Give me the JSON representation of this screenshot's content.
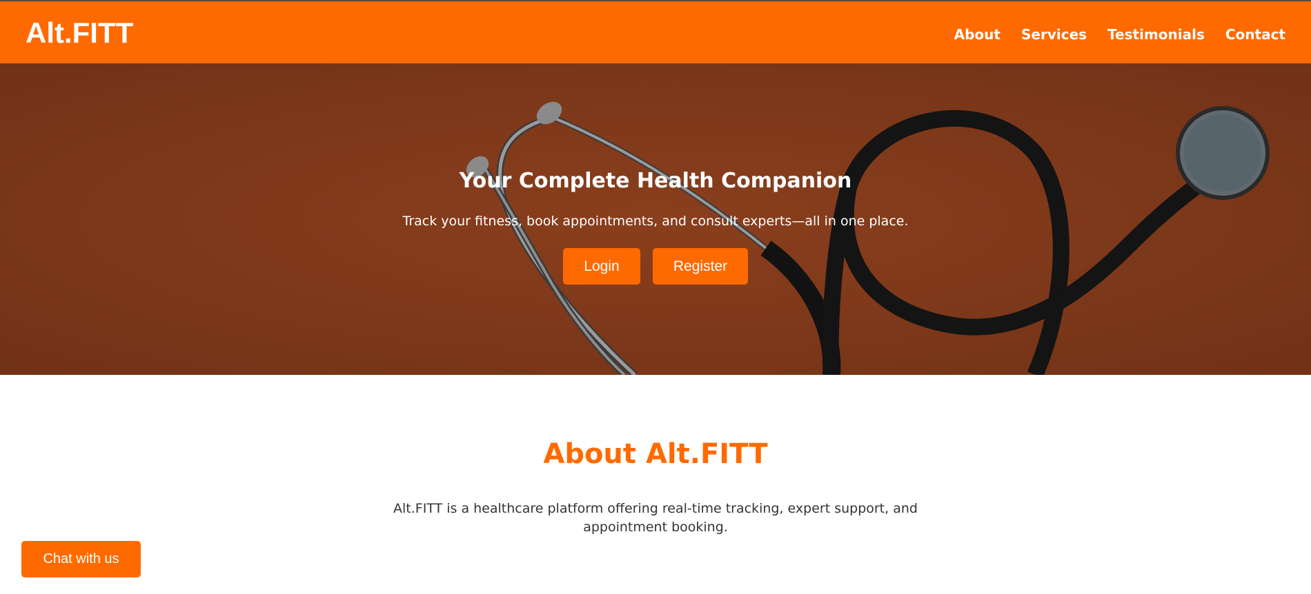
{
  "brand": {
    "logo": "Alt.FITT",
    "accent": "#ff6a00",
    "hero_bg": "#7b371a"
  },
  "nav": {
    "items": [
      {
        "label": "About"
      },
      {
        "label": "Services"
      },
      {
        "label": "Testimonials"
      },
      {
        "label": "Contact"
      }
    ]
  },
  "hero": {
    "title": "Your Complete Health Companion",
    "subtitle": "Track your fitness, book appointments, and consult experts—all in one place.",
    "login_label": "Login",
    "register_label": "Register",
    "image": "stethoscope-image"
  },
  "about": {
    "title": "About Alt.FITT",
    "text": "Alt.FITT is a healthcare platform offering real-time tracking, expert support, and appointment booking."
  },
  "chat": {
    "label": "Chat with us"
  }
}
